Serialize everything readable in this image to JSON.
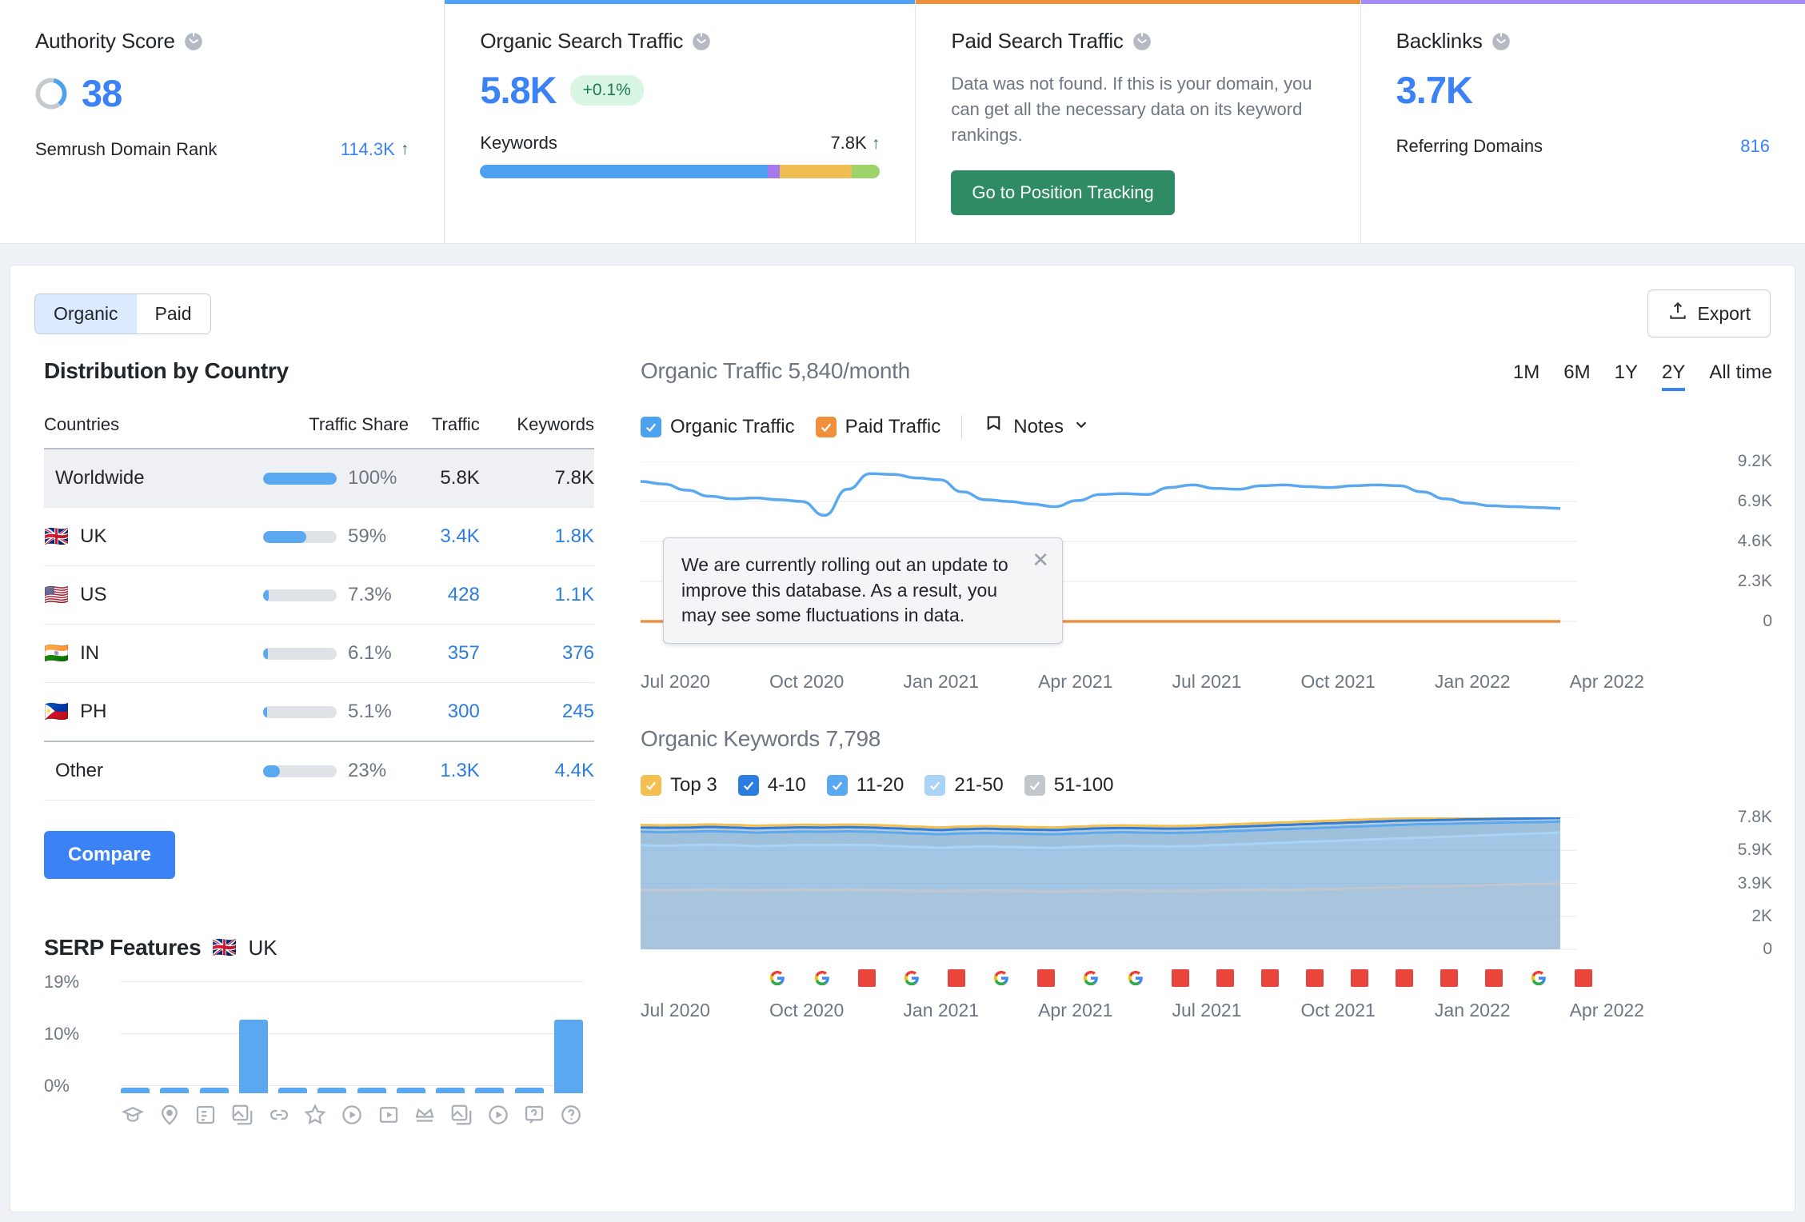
{
  "cards": {
    "authority": {
      "title": "Authority Score",
      "score": "38",
      "foot_label": "Semrush Domain Rank",
      "foot_value": "114.3K",
      "trend": "↑"
    },
    "organic": {
      "title": "Organic Search Traffic",
      "value": "5.8K",
      "change": "+0.1%",
      "kw_label": "Keywords",
      "kw_value": "7.8K",
      "trend": "↑"
    },
    "paid": {
      "title": "Paid Search Traffic",
      "message": "Data was not found. If this is your domain, you can get all the necessary data on its keyword rankings.",
      "button": "Go to Position Tracking"
    },
    "backlinks": {
      "title": "Backlinks",
      "value": "3.7K",
      "foot_label": "Referring Domains",
      "foot_value": "816"
    }
  },
  "toolbar": {
    "tab_organic": "Organic",
    "tab_paid": "Paid",
    "export": "Export"
  },
  "country": {
    "heading": "Distribution by Country",
    "columns": [
      "Countries",
      "Traffic Share",
      "Traffic",
      "Keywords"
    ],
    "rows": [
      {
        "flag": "",
        "name": "Worldwide",
        "share_pct": 100,
        "share": "100%",
        "traffic": "5.8K",
        "keywords": "7.8K"
      },
      {
        "flag": "🇬🇧",
        "name": "UK",
        "share_pct": 59,
        "share": "59%",
        "traffic": "3.4K",
        "keywords": "1.8K"
      },
      {
        "flag": "🇺🇸",
        "name": "US",
        "share_pct": 7.3,
        "share": "7.3%",
        "traffic": "428",
        "keywords": "1.1K"
      },
      {
        "flag": "🇮🇳",
        "name": "IN",
        "share_pct": 6.1,
        "share": "6.1%",
        "traffic": "357",
        "keywords": "376"
      },
      {
        "flag": "🇵🇭",
        "name": "PH",
        "share_pct": 5.1,
        "share": "5.1%",
        "traffic": "300",
        "keywords": "245"
      },
      {
        "flag": "",
        "name": "Other",
        "share_pct": 23,
        "share": "23%",
        "traffic": "1.3K",
        "keywords": "4.4K"
      }
    ],
    "compare": "Compare"
  },
  "serp": {
    "heading": "SERP Features",
    "flag": "🇬🇧",
    "country": "UK",
    "chart_data": {
      "type": "bar",
      "title": "SERP Features",
      "categories": [
        "knowledge-panel",
        "local-pack",
        "sitelinks",
        "image-pack",
        "links",
        "reviews",
        "video",
        "video-carousel",
        "featured-snippet",
        "images",
        "instant-answer",
        "faq"
      ],
      "values": [
        0.6,
        0.6,
        0.6,
        13.5,
        0.6,
        0.6,
        0.6,
        0.6,
        1.0,
        0.6,
        0.6,
        13.5
      ],
      "ylabel": "",
      "xlabel": "",
      "ytick_labels": [
        "0%",
        "10%",
        "19%"
      ],
      "ylim": [
        0,
        19
      ]
    }
  },
  "traffic_chart": {
    "title": "Organic Traffic",
    "subtitle": "5,840/month",
    "periods": [
      "1M",
      "6M",
      "1Y",
      "2Y",
      "All time"
    ],
    "active_period": "2Y",
    "legend": [
      {
        "label": "Organic Traffic",
        "color": "#4da2f0",
        "checked": true
      },
      {
        "label": "Paid Traffic",
        "color": "#f0903d",
        "checked": true
      }
    ],
    "notes_label": "Notes",
    "tooltip": "We are currently rolling out an update to improve this database. As a result, you may see some fluctuations in data.",
    "chart_data": {
      "type": "line",
      "title": "Organic Traffic",
      "ylabel": "",
      "xlabel": "",
      "ytick_labels": [
        "0",
        "2.3K",
        "4.6K",
        "6.9K",
        "9.2K"
      ],
      "ylim": [
        0,
        9200
      ],
      "xtick_labels": [
        "Jul 2020",
        "Oct 2020",
        "Jan 2021",
        "Apr 2021",
        "Jul 2021",
        "Oct 2021",
        "Jan 2022",
        "Apr 2022"
      ],
      "series": [
        {
          "name": "Organic Traffic",
          "color": "#5aa9f0",
          "values": [
            8050,
            7900,
            7550,
            7200,
            7050,
            7100,
            7000,
            6900,
            6100,
            7600,
            8500,
            8450,
            8250,
            8150,
            7450,
            7000,
            6900,
            6750,
            6600,
            6950,
            7300,
            7350,
            7300,
            7700,
            7850,
            7650,
            7600,
            7800,
            7850,
            7750,
            7700,
            7800,
            7850,
            7800,
            7450,
            7050,
            6800,
            6650,
            6600,
            6550,
            6500
          ]
        },
        {
          "name": "Paid Traffic",
          "color": "#f0903d",
          "values": [
            0,
            0,
            0,
            0,
            0,
            0,
            0,
            0,
            0,
            0,
            0,
            0,
            0,
            0,
            0,
            0,
            0,
            0,
            0,
            0,
            0,
            0,
            0,
            0,
            0,
            0,
            0,
            0,
            0,
            0,
            0,
            0,
            0,
            0,
            0,
            0,
            0,
            0,
            0,
            0,
            0
          ]
        }
      ]
    }
  },
  "keywords_chart": {
    "title": "Organic Keywords",
    "subtitle": "7,798",
    "legend": [
      {
        "label": "Top 3",
        "color": "#f5bf4f",
        "checked": true
      },
      {
        "label": "4-10",
        "color": "#2b7de0",
        "checked": true
      },
      {
        "label": "11-20",
        "color": "#5aa9f0",
        "checked": true
      },
      {
        "label": "21-50",
        "color": "#a9d3f7",
        "checked": true
      },
      {
        "label": "51-100",
        "color": "#c2c6cd",
        "checked": true
      }
    ],
    "chart_data": {
      "type": "area",
      "title": "Organic Keywords",
      "ytick_labels": [
        "0",
        "2K",
        "3.9K",
        "5.9K",
        "7.8K"
      ],
      "ylim": [
        0,
        7800
      ],
      "xtick_labels": [
        "Jul 2020",
        "Oct 2020",
        "Jan 2021",
        "Apr 2021",
        "Jul 2021",
        "Oct 2021",
        "Jan 2022",
        "Apr 2022"
      ],
      "series": [
        {
          "name": "51-100",
          "color": "#c2c6cd",
          "values": [
            3500,
            3480,
            3500,
            3520,
            3500,
            3480,
            3500,
            3520,
            3500,
            3520,
            3500,
            3480,
            3460,
            3440,
            3460,
            3480,
            3460,
            3440,
            3420,
            3440,
            3460,
            3480,
            3460,
            3440,
            3460,
            3480,
            3500,
            3520,
            3500,
            3520,
            3560,
            3600,
            3640,
            3680,
            3700,
            3720,
            3760,
            3800,
            3840,
            3860,
            3900
          ]
        },
        {
          "name": "21-50",
          "color": "#a9d3f7",
          "values": [
            6150,
            6120,
            6150,
            6180,
            6150,
            6100,
            6130,
            6160,
            6150,
            6170,
            6150,
            6100,
            6050,
            6000,
            6050,
            6080,
            6050,
            6020,
            6000,
            6050,
            6100,
            6120,
            6100,
            6080,
            6100,
            6150,
            6200,
            6250,
            6300,
            6350,
            6400,
            6450,
            6500,
            6550,
            6600,
            6650,
            6700,
            6750,
            6800,
            6850,
            6900
          ]
        },
        {
          "name": "11-20",
          "color": "#5aa9f0",
          "values": [
            6950,
            6920,
            6950,
            6980,
            6950,
            6900,
            6930,
            6960,
            6950,
            6970,
            6950,
            6900,
            6850,
            6800,
            6850,
            6880,
            6850,
            6820,
            6800,
            6850,
            6900,
            6920,
            6900,
            6880,
            6900,
            6950,
            7000,
            7050,
            7100,
            7150,
            7200,
            7250,
            7300,
            7350,
            7400,
            7420,
            7450,
            7480,
            7500,
            7520,
            7550
          ]
        },
        {
          "name": "4-10",
          "color": "#2b7de0",
          "values": [
            7200,
            7180,
            7200,
            7230,
            7200,
            7150,
            7180,
            7210,
            7200,
            7220,
            7200,
            7150,
            7100,
            7050,
            7100,
            7130,
            7100,
            7070,
            7050,
            7100,
            7150,
            7170,
            7150,
            7130,
            7150,
            7200,
            7250,
            7300,
            7350,
            7400,
            7450,
            7500,
            7550,
            7600,
            7620,
            7650,
            7680,
            7700,
            7720,
            7740,
            7760
          ]
        },
        {
          "name": "Top 3",
          "color": "#f5bf4f",
          "values": [
            7350,
            7330,
            7350,
            7380,
            7350,
            7300,
            7330,
            7360,
            7350,
            7370,
            7350,
            7300,
            7250,
            7200,
            7250,
            7280,
            7250,
            7220,
            7200,
            7250,
            7300,
            7320,
            7300,
            7280,
            7300,
            7350,
            7400,
            7450,
            7500,
            7550,
            7600,
            7650,
            7690,
            7720,
            7740,
            7760,
            7770,
            7780,
            7790,
            7795,
            7798
          ]
        }
      ]
    }
  }
}
